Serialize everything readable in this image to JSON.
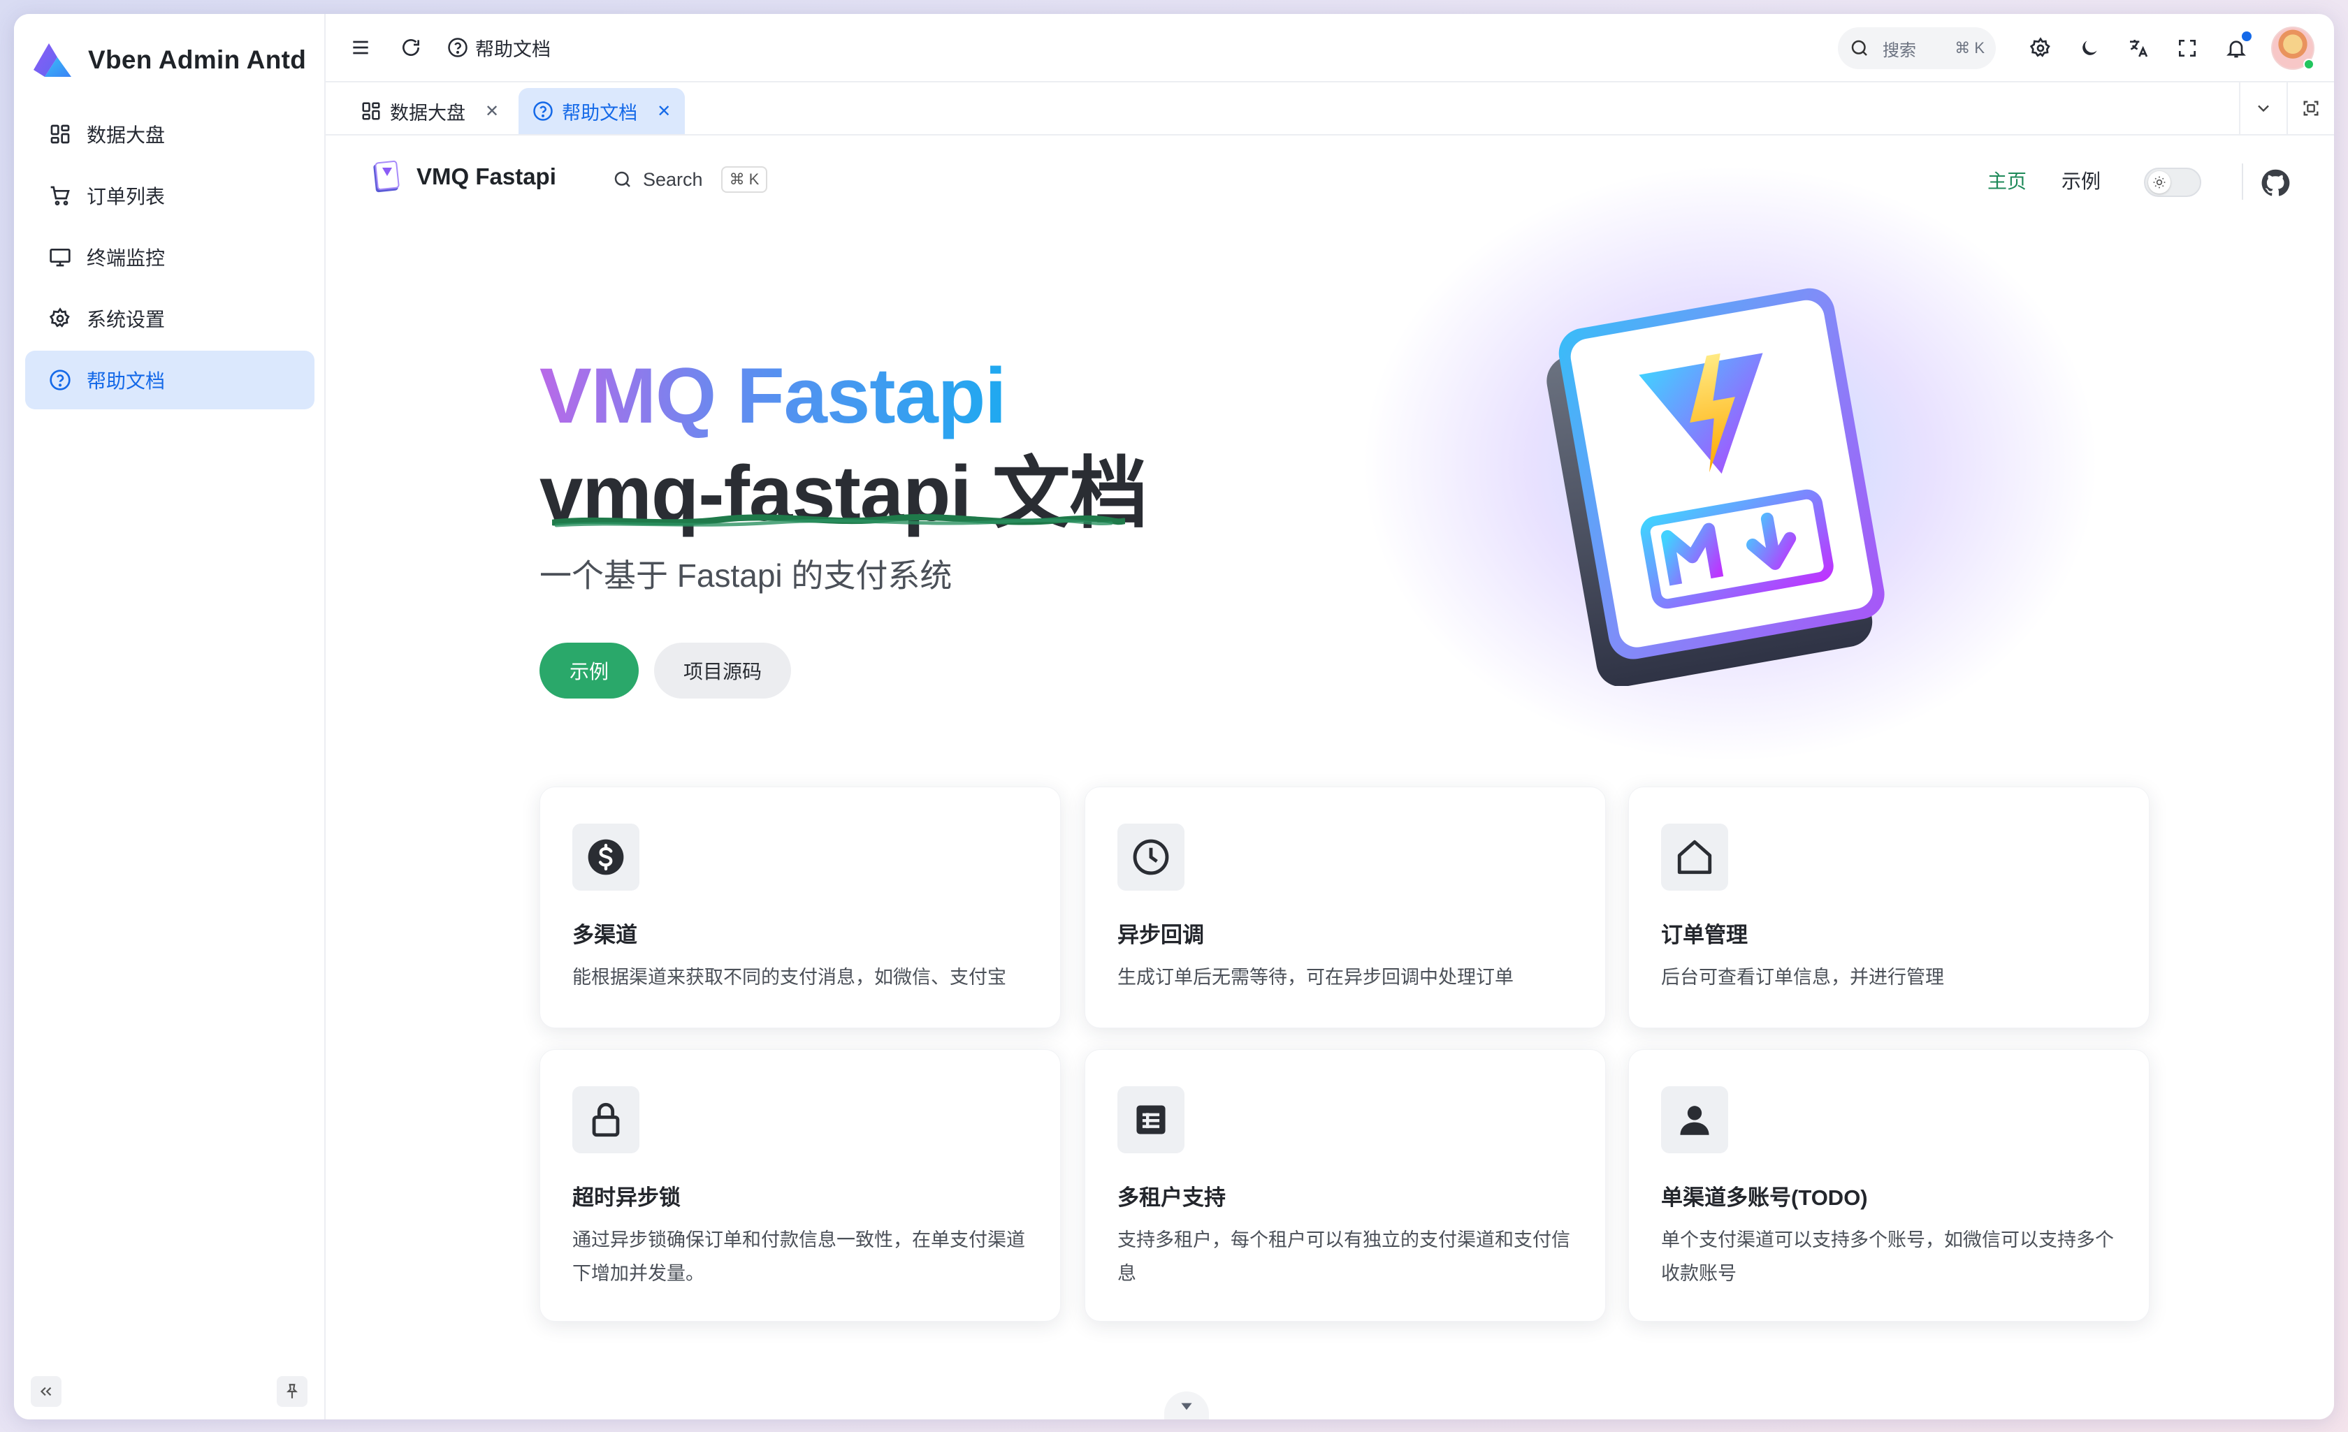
{
  "app": {
    "title": "Vben Admin Antd"
  },
  "sidebar": {
    "items": [
      {
        "label": "数据大盘",
        "icon": "dashboard-grid-icon"
      },
      {
        "label": "订单列表",
        "icon": "cart-icon"
      },
      {
        "label": "终端监控",
        "icon": "monitor-icon"
      },
      {
        "label": "系统设置",
        "icon": "gear-icon"
      },
      {
        "label": "帮助文档",
        "icon": "help-circle-icon",
        "active": true
      }
    ]
  },
  "header": {
    "breadcrumb": "帮助文档",
    "search": {
      "placeholder": "搜索",
      "shortcut": "⌘ K"
    }
  },
  "tabs": [
    {
      "label": "数据大盘",
      "icon": "dashboard-grid-icon",
      "active": false
    },
    {
      "label": "帮助文档",
      "icon": "help-circle-icon",
      "active": true
    }
  ],
  "doc": {
    "nav": {
      "title": "VMQ Fastapi",
      "search_label": "Search",
      "search_shortcut": "⌘ K",
      "links": {
        "home": "主页",
        "examples": "示例"
      }
    },
    "hero": {
      "name": "VMQ Fastapi",
      "text": "vmq-fastapi 文档",
      "tagline": "一个基于 Fastapi 的支付系统",
      "primary_button": "示例",
      "secondary_button": "项目源码"
    },
    "features": [
      {
        "icon": "dollar-icon",
        "title": "多渠道",
        "desc": "能根据渠道来获取不同的支付消息，如微信、支付宝"
      },
      {
        "icon": "clock-icon",
        "title": "异步回调",
        "desc": "生成订单后无需等待，可在异步回调中处理订单"
      },
      {
        "icon": "home-icon",
        "title": "订单管理",
        "desc": "后台可查看订单信息，并进行管理"
      },
      {
        "icon": "lock-icon",
        "title": "超时异步锁",
        "desc": "通过异步锁确保订单和付款信息一致性，在单支付渠道下增加并发量。"
      },
      {
        "icon": "table-icon",
        "title": "多租户支持",
        "desc": "支持多租户，每个租户可以有独立的支付渠道和支付信息"
      },
      {
        "icon": "user-icon",
        "title": "单渠道多账号(TODO)",
        "desc": "单个支付渠道可以支持多个账号，如微信可以支持多个收款账号"
      }
    ]
  },
  "colors": {
    "accent": "#1469e8",
    "active_bg": "#dbe8fd",
    "doc_brand": "#2aa86a",
    "notification_dot": "#1469e8"
  }
}
